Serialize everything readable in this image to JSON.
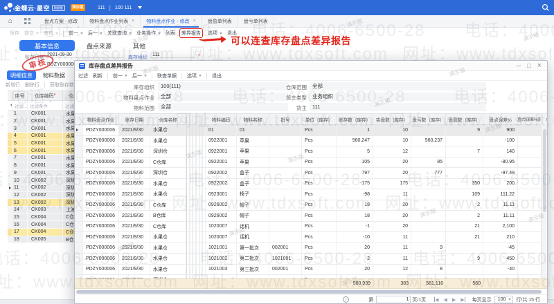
{
  "topbar": {
    "logo": "金蝶云·星空",
    "edition_badge": "旗舰版",
    "demo_badge": "演示版",
    "org": "111",
    "user": "100 111"
  },
  "tabbar": {
    "tabs": [
      {
        "label": "盘点方案 - 修改",
        "closable": false,
        "active": false
      },
      {
        "label": "物料盘点作业列表",
        "closable": true,
        "active": false
      },
      {
        "label": "物料盘点作业 - 修改",
        "closable": true,
        "active": true
      },
      {
        "label": "盘盈单列表",
        "closable": false,
        "active": false
      },
      {
        "label": "盘亏单列表",
        "closable": false,
        "active": false
      }
    ]
  },
  "toolbar": {
    "items": [
      {
        "label": "保存",
        "disabled": true
      },
      {
        "label": "提交",
        "caret": true,
        "disabled": true
      },
      {
        "label": "审核",
        "caret": true,
        "disabled": true
      },
      {
        "divider": true
      },
      {
        "label": "前一",
        "caret": true
      },
      {
        "label": "后一",
        "caret": true
      },
      {
        "label": "关联查询",
        "caret": true
      },
      {
        "label": "业务操作",
        "caret": true
      },
      {
        "label": "列表"
      },
      {
        "label": "差异报告",
        "highlighted": true
      },
      {
        "label": "选项",
        "caret": true
      },
      {
        "label": "退出"
      }
    ]
  },
  "annotation": {
    "text": "可以连查库存盘点差异报告"
  },
  "form": {
    "tabs": [
      {
        "label": "基本信息",
        "active": true
      },
      {
        "label": "盘点来源",
        "active": false
      },
      {
        "label": "其他",
        "active": false
      }
    ],
    "date_label": "账存日期",
    "date_value": "2021-09-30",
    "org_label": "库存组织",
    "org_value": "111",
    "bill_no": "PDZY000006",
    "stamp": "审核"
  },
  "left_panel": {
    "tabs": [
      {
        "label": "明细信息",
        "active": true
      },
      {
        "label": "物料数据",
        "active": false
      }
    ],
    "toolbar": [
      "新增行",
      "删除行",
      "获取账存数"
    ],
    "headers": [
      "序号",
      "仓库编码",
      "仓库名称"
    ],
    "filter_row": [
      "过滤...",
      "过滤条件",
      "过滤"
    ],
    "rows": [
      {
        "num": "1",
        "code": "CK001",
        "name": "水果仓"
      },
      {
        "num": "2",
        "code": "CK001",
        "name": "水果仓"
      },
      {
        "num": "3",
        "code": "CK001",
        "name": "水果仓"
      },
      {
        "num": "4",
        "code": "CK001",
        "name": "水果仓",
        "highlight": true
      },
      {
        "num": "5",
        "code": "CK001",
        "name": "水果仓",
        "highlight": true
      },
      {
        "num": "6",
        "code": "CK001",
        "name": "水果仓",
        "highlight": true
      },
      {
        "num": "7",
        "code": "CK001",
        "name": "水果仓"
      },
      {
        "num": "8",
        "code": "CK001",
        "name": "水果仓"
      },
      {
        "num": "9",
        "code": "CK001",
        "name": "水果仓"
      },
      {
        "num": "10",
        "code": "CK002",
        "name": "深圳仓"
      },
      {
        "num": "11",
        "code": "CK002",
        "name": "深圳仓",
        "current": true
      },
      {
        "num": "12",
        "code": "CK002",
        "name": "深圳仓"
      },
      {
        "num": "13",
        "code": "CK002",
        "name": "深圳仓",
        "highlight": true
      },
      {
        "num": "14",
        "code": "CK003",
        "name": "上海仓"
      },
      {
        "num": "15",
        "code": "CK004",
        "name": "C仓库"
      },
      {
        "num": "16",
        "code": "CK004",
        "name": "C仓库"
      },
      {
        "num": "17",
        "code": "CK004",
        "name": "C仓库",
        "highlight": true
      },
      {
        "num": "18",
        "code": "CK005",
        "name": "B仓库"
      }
    ]
  },
  "dialog": {
    "title": "库存盘点差异报告",
    "controls": [
      "─",
      "□",
      "×"
    ],
    "toolbar": [
      {
        "label": "过滤"
      },
      {
        "label": "刷新"
      },
      {
        "divider": true
      },
      {
        "label": "前一",
        "caret": true
      },
      {
        "label": "后一",
        "caret": true
      },
      {
        "divider": true
      },
      {
        "label": "联查单据"
      },
      {
        "divider": true
      },
      {
        "label": "选项",
        "caret": true
      },
      {
        "divider": true
      },
      {
        "label": "退出"
      }
    ],
    "filters_left": [
      {
        "label": "库存组织",
        "value": "100(111)"
      },
      {
        "label": "物料盘点作业",
        "value": "全部"
      },
      {
        "label": "物料范围",
        "value": "全部"
      }
    ],
    "filters_right": [
      {
        "label": "仓库范围",
        "value": "全部"
      },
      {
        "label": "货主类型",
        "value": "业务组织"
      },
      {
        "label": "货主",
        "value": "111"
      }
    ],
    "grid": {
      "columns": [
        {
          "key": "ind",
          "label": "",
          "w": 12,
          "type": "indicator"
        },
        {
          "key": "job",
          "label": "物料盘点作业",
          "w": 52
        },
        {
          "key": "date",
          "label": "账存日期",
          "w": 45
        },
        {
          "key": "wh",
          "label": "仓库名称",
          "w": 52
        },
        {
          "key": "hatch",
          "label": "",
          "w": 28,
          "type": "hatch"
        },
        {
          "key": "code",
          "label": "物料编码",
          "w": 45
        },
        {
          "key": "name",
          "label": "物料名称",
          "w": 47
        },
        {
          "key": "batch",
          "label": "批号",
          "w": 47
        },
        {
          "key": "unit",
          "label": "单位（库存）",
          "w": 50
        },
        {
          "key": "book",
          "label": "账存数（库存）",
          "w": 53,
          "align": "right"
        },
        {
          "key": "real",
          "label": "实盘数（库存）",
          "w": 55,
          "align": "right"
        },
        {
          "key": "loss",
          "label": "盘亏数（库存）",
          "w": 50,
          "align": "right"
        },
        {
          "key": "gain",
          "label": "盘盈数（库存）",
          "w": 54,
          "align": "right"
        },
        {
          "key": "err",
          "label": "盘点误差%",
          "w": 50,
          "align": "right"
        },
        {
          "key": "err2",
          "label": "盘点误差%(辅助)",
          "w": 44,
          "align": "right"
        }
      ],
      "rows": [
        {
          "job": "PDZY000006",
          "date": "2021/9/30",
          "wh": "水果仓",
          "code": "01",
          "name": "01",
          "batch": "",
          "unit": "Pcs",
          "book": "1",
          "real": "10",
          "loss": "",
          "gain": "9",
          "err": "900",
          "err2": "",
          "current": true
        },
        {
          "job": "PDZY000006",
          "date": "2021/9/30",
          "wh": "水果仓",
          "code": "0922001",
          "name": "苹果",
          "batch": "",
          "unit": "Pcs",
          "book": "560,247",
          "real": "10",
          "loss": "560,237",
          "gain": "",
          "err": "-100",
          "err2": ""
        },
        {
          "job": "PDZY000006",
          "date": "2021/9/30",
          "wh": "深圳仓",
          "code": "0922001",
          "name": "苹果",
          "batch": "",
          "unit": "Pcs",
          "book": "5",
          "real": "12",
          "loss": "",
          "gain": "7",
          "err": "140",
          "err2": ""
        },
        {
          "job": "PDZY000006",
          "date": "2021/9/30",
          "wh": "C仓库",
          "code": "0922001",
          "name": "苹果",
          "batch": "",
          "unit": "Pcs",
          "book": "105",
          "real": "20",
          "loss": "85",
          "gain": "",
          "err": "-80.95",
          "err2": ""
        },
        {
          "job": "PDZY000006",
          "date": "2021/9/30",
          "wh": "深圳仓",
          "code": "0922002",
          "name": "盒子",
          "batch": "",
          "unit": "Pcs",
          "book": "797",
          "real": "20",
          "loss": "777",
          "gain": "",
          "err": "-97.49",
          "err2": ""
        },
        {
          "job": "PDZY000006",
          "date": "2021/9/30",
          "wh": "水果仓",
          "code": "0922002",
          "name": "盒子",
          "batch": "",
          "unit": "Pcs",
          "book": "-175",
          "real": "175",
          "loss": "",
          "gain": "350",
          "err": "200",
          "err2": ""
        },
        {
          "job": "PDZY000006",
          "date": "2021/9/30",
          "wh": "水果仓",
          "code": "0923001",
          "name": "椅子",
          "batch": "",
          "unit": "Pcs",
          "book": "-98",
          "real": "11",
          "loss": "",
          "gain": "109",
          "err": "111.22",
          "err2": ""
        },
        {
          "job": "PDZY000006",
          "date": "2021/9/30",
          "wh": "C仓库",
          "code": "0926002",
          "name": "帽子",
          "batch": "",
          "unit": "Pcs",
          "book": "18",
          "real": "20",
          "loss": "",
          "gain": "2",
          "err": "11.11",
          "err2": ""
        },
        {
          "job": "PDZY000006",
          "date": "2021/9/30",
          "wh": "B仓库",
          "code": "0926002",
          "name": "帽子",
          "batch": "",
          "unit": "Pcs",
          "book": "18",
          "real": "20",
          "loss": "",
          "gain": "2",
          "err": "11.11",
          "err2": ""
        },
        {
          "job": "PDZY000006",
          "date": "2021/9/30",
          "wh": "C仓库",
          "code": "1020007",
          "name": "话机",
          "batch": "",
          "unit": "Pcs",
          "book": "-1",
          "real": "20",
          "loss": "",
          "gain": "21",
          "err": "2,100",
          "err2": ""
        },
        {
          "job": "PDZY000006",
          "date": "2021/9/30",
          "wh": "水果仓",
          "code": "1020007",
          "name": "话机",
          "batch": "",
          "unit": "Pcs",
          "book": "-10",
          "real": "11",
          "loss": "",
          "gain": "21",
          "err": "210",
          "err2": ""
        },
        {
          "job": "PDZY000006",
          "date": "2021/9/30",
          "wh": "水果仓",
          "code": "1021001",
          "name": "第一批次",
          "batch": "002001",
          "unit": "Pcs",
          "book": "20",
          "real": "11",
          "loss": "9",
          "gain": "",
          "err": "-45",
          "err2": ""
        },
        {
          "job": "PDZY000006",
          "date": "2021/9/30",
          "wh": "水果仓",
          "code": "1021002",
          "name": "第二批次",
          "batch": "1021001",
          "unit": "Pcs",
          "book": "2",
          "real": "11",
          "loss": "",
          "gain": "9",
          "err": "450",
          "err2": ""
        },
        {
          "job": "PDZY000006",
          "date": "2021/9/30",
          "wh": "水果仓",
          "code": "1021003",
          "name": "第三批次",
          "batch": "002001",
          "unit": "Pcs",
          "book": "20",
          "real": "12",
          "loss": "8",
          "gain": "",
          "err": "-40",
          "err2": ""
        },
        {
          "job": "PDZY000006",
          "date": "2021/9/30",
          "wh": "深圳仓",
          "code": "",
          "name": "",
          "batch": "",
          "unit": "Pcs",
          "book": "",
          "real": "",
          "loss": "",
          "gain": "",
          "err": "",
          "err2": ""
        }
      ],
      "summary": {
        "book": "560,939",
        "real": "383",
        "loss": "561,116",
        "gain": "560"
      }
    },
    "pager": {
      "page_pre": "第",
      "page_value": "1",
      "page_post": "页/1页",
      "per_page_label": "每页显示",
      "per_page": "100",
      "rows_label": "行/共 15 行"
    }
  },
  "watermark": {
    "phone": "电话：4006-6500-28",
    "site": "网址：www.tdxsoft.com",
    "demo": "演示版"
  }
}
